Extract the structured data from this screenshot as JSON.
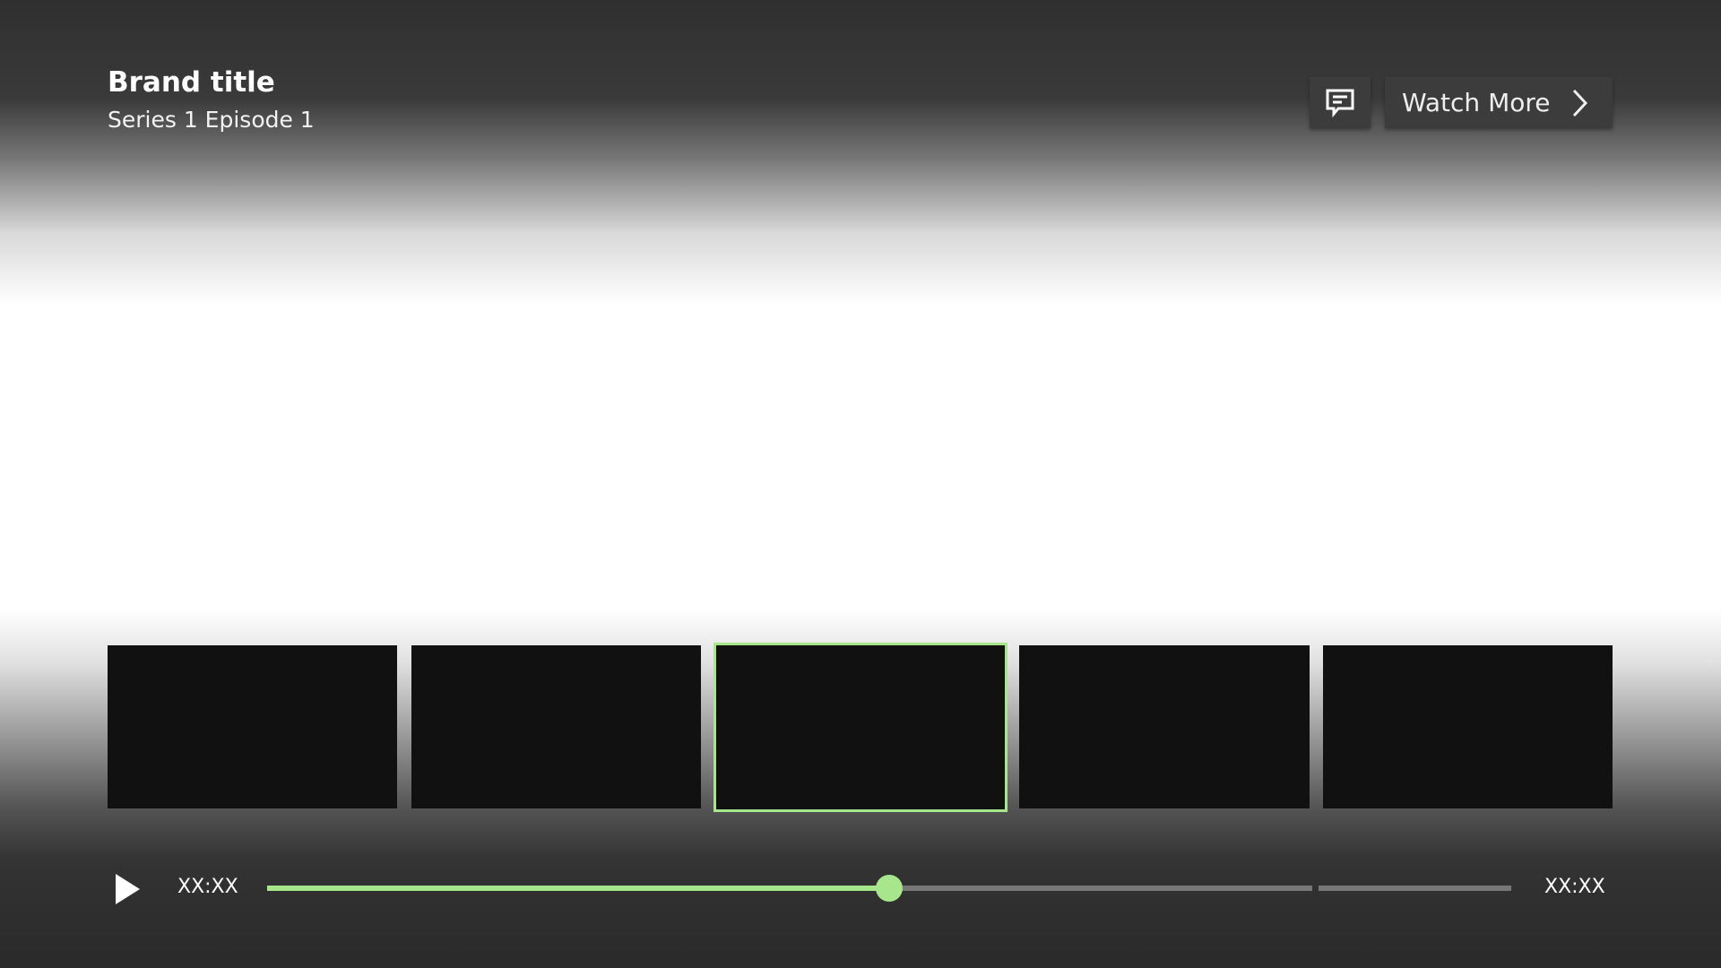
{
  "header": {
    "title": "Brand title",
    "subtitle": "Series 1 Episode 1"
  },
  "actions": {
    "subtitles_icon": "subtitles-speech-bubble-icon",
    "watch_more_label": "Watch More",
    "watch_more_icon": "chevron-right-icon"
  },
  "thumbnails": {
    "count": 5,
    "selected_index": 2,
    "accent_color": "#a8e68c"
  },
  "player": {
    "play_icon": "play-icon",
    "elapsed_time": "XX:XX",
    "total_time": "XX:XX",
    "progress": 0.5,
    "progress_color": "#a8e68c",
    "track_color": "#777777"
  }
}
